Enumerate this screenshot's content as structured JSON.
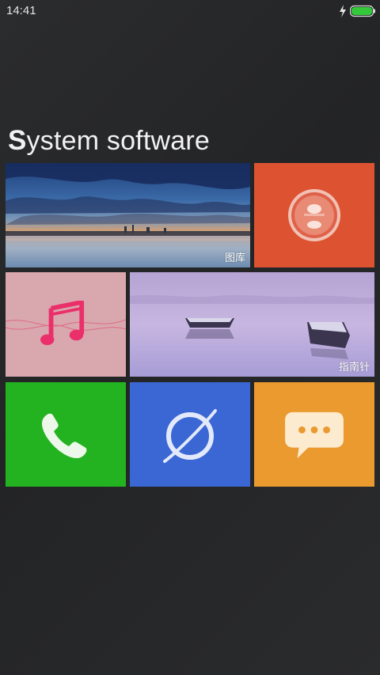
{
  "status_bar": {
    "time": "14:41",
    "icons": [
      "charging-icon",
      "battery-icon"
    ],
    "battery_color": "#34c93a"
  },
  "section": {
    "title_first": "S",
    "title_rest": "ystem software"
  },
  "tiles": {
    "gallery": {
      "label": "图库",
      "icon": "landscape-photo"
    },
    "camera": {
      "icon": "camera-lens-icon",
      "color": "#dd5331"
    },
    "music": {
      "icon": "music-note-icon",
      "color": "#d8a8ae"
    },
    "compass": {
      "label": "指南针",
      "icon": "boats-photo"
    },
    "phone": {
      "icon": "phone-icon",
      "color": "#23b320"
    },
    "browser": {
      "icon": "planet-browser-icon",
      "color": "#3a67d3"
    },
    "messages": {
      "icon": "chat-bubble-icon",
      "color": "#ea9a2f"
    }
  }
}
